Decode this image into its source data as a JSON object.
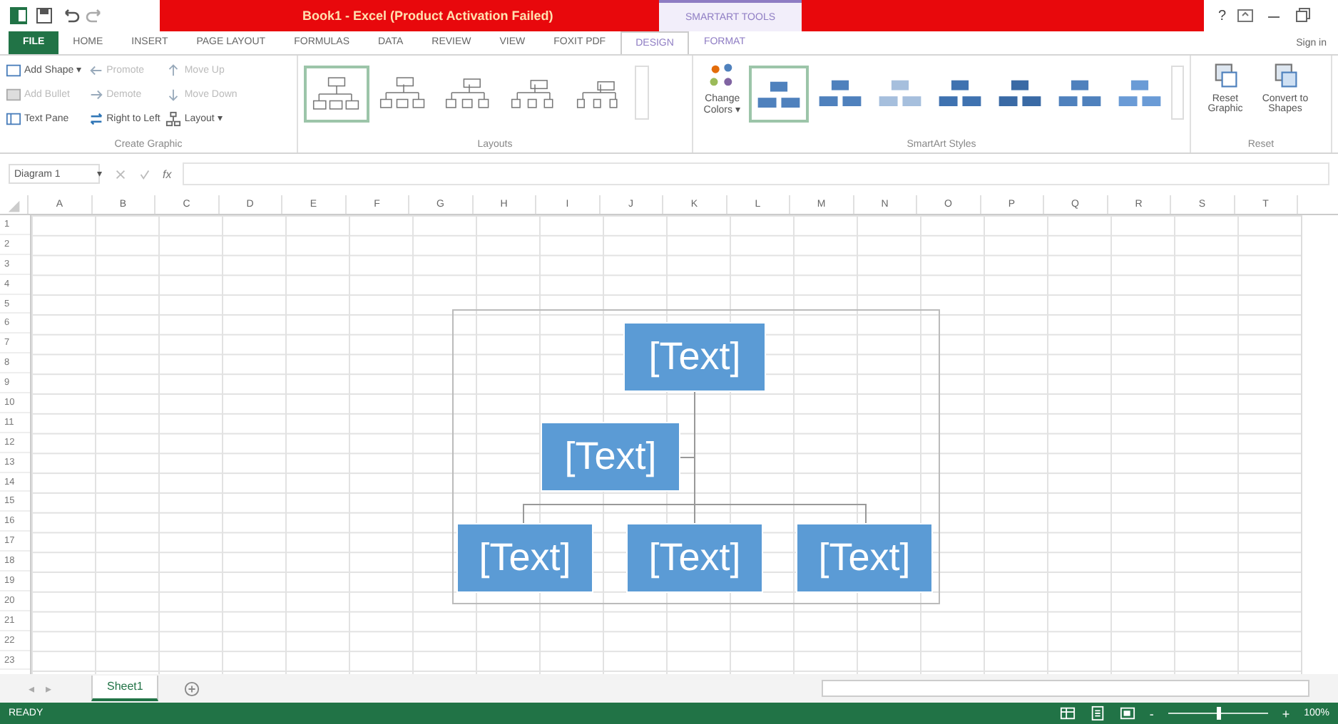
{
  "window": {
    "title": "Book1 - Excel (Product Activation Failed)",
    "contextual_group": "SMARTART TOOLS",
    "help": "?",
    "sign_in": "Sign in"
  },
  "tabs": [
    {
      "label": "FILE",
      "kind": "file",
      "selected": false
    },
    {
      "label": "HOME",
      "kind": "tab",
      "selected": false
    },
    {
      "label": "INSERT",
      "kind": "tab",
      "selected": false
    },
    {
      "label": "PAGE LAYOUT",
      "kind": "tab",
      "selected": false
    },
    {
      "label": "FORMULAS",
      "kind": "tab",
      "selected": false
    },
    {
      "label": "DATA",
      "kind": "tab",
      "selected": false
    },
    {
      "label": "REVIEW",
      "kind": "tab",
      "selected": false
    },
    {
      "label": "VIEW",
      "kind": "tab",
      "selected": false
    },
    {
      "label": "FOXIT PDF",
      "kind": "tab",
      "selected": false
    },
    {
      "label": "DESIGN",
      "kind": "contextual",
      "selected": true
    },
    {
      "label": "FORMAT",
      "kind": "contextual",
      "selected": false
    }
  ],
  "create_graphic": {
    "label": "Create Graphic",
    "columns": [
      [
        {
          "label": "Add Shape ▾",
          "disabled": false
        },
        {
          "label": "Add Bullet",
          "disabled": true
        },
        {
          "label": "Text Pane",
          "disabled": false
        }
      ],
      [
        {
          "label": "Promote",
          "disabled": true
        },
        {
          "label": "Demote",
          "disabled": true
        },
        {
          "label": "Right to Left",
          "disabled": false
        }
      ],
      [
        {
          "label": "Move Up",
          "disabled": true
        },
        {
          "label": "Move Down",
          "disabled": true
        },
        {
          "label": "Layout ▾",
          "disabled": false
        }
      ]
    ]
  },
  "layouts": {
    "label": "Layouts",
    "items": [
      {
        "selected": true
      },
      {
        "selected": false
      },
      {
        "selected": false
      },
      {
        "selected": false
      },
      {
        "selected": false
      }
    ]
  },
  "change_colors": {
    "label": "Change Colors ▾"
  },
  "smartart_styles": {
    "label": "SmartArt Styles",
    "items": [
      {
        "selected": true
      },
      {
        "selected": false
      },
      {
        "selected": false
      },
      {
        "selected": false
      },
      {
        "selected": false
      },
      {
        "selected": false
      },
      {
        "selected": false
      }
    ]
  },
  "reset": {
    "label": "Reset",
    "buttons": [
      "Reset Graphic",
      "Convert to Shapes"
    ]
  },
  "formula_bar": {
    "name_box": "Diagram 1",
    "name_box_caret": "▾",
    "fx": "fx"
  },
  "columns": [
    "A",
    "B",
    "C",
    "D",
    "E",
    "F",
    "G",
    "H",
    "I",
    "J",
    "K",
    "L",
    "M",
    "N",
    "O",
    "P",
    "Q",
    "R",
    "S",
    "T"
  ],
  "rows": [
    "1",
    "2",
    "3",
    "4",
    "5",
    "6",
    "7",
    "8",
    "9",
    "10",
    "11",
    "12",
    "13",
    "14",
    "15",
    "16",
    "17",
    "18",
    "19",
    "20",
    "21",
    "22",
    "23"
  ],
  "smartart": {
    "top": "[Text]",
    "middle": "[Text]",
    "bottom": [
      "[Text]",
      "[Text]",
      "[Text]"
    ]
  },
  "sheet_nav": [
    "◂",
    "▸"
  ],
  "sheets": [
    {
      "label": "Sheet1",
      "selected": true
    }
  ],
  "status_bar": {
    "status": "READY",
    "zoom_out": "-",
    "zoom_in": "+",
    "zoom": "100%",
    "zoom_level": {
      "level": 0.5
    }
  }
}
